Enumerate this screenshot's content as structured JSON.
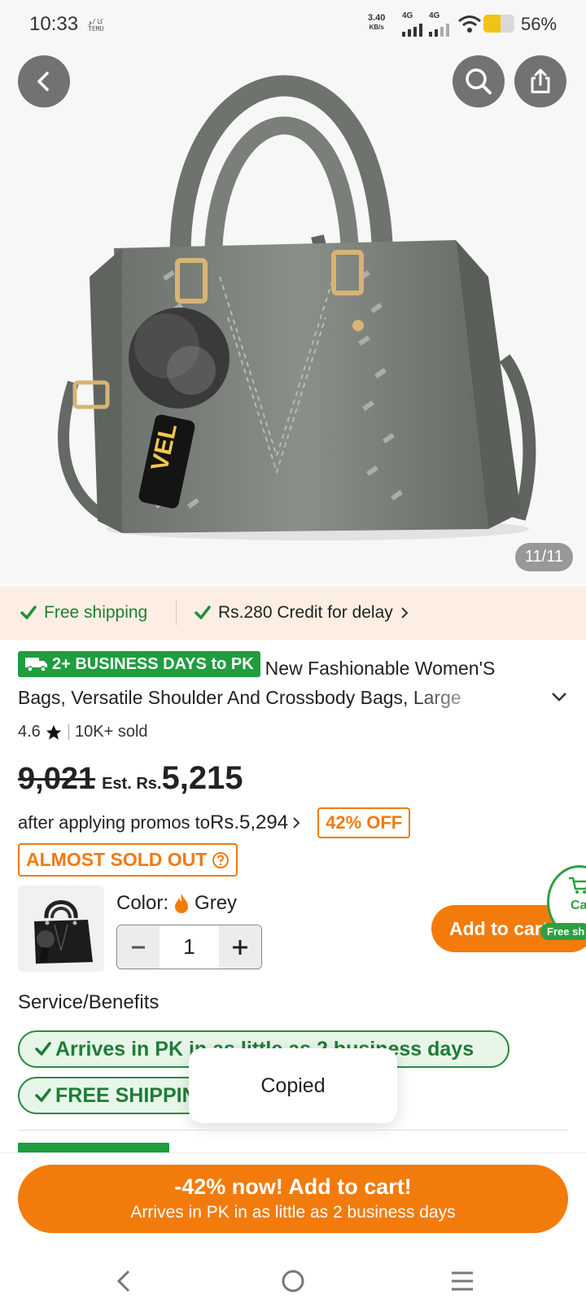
{
  "status_bar": {
    "time": "10:33",
    "app_mark_line1": "ﻛﺎ/ﻭ",
    "app_mark_line2": "TEMU",
    "net_speed": "3.40",
    "net_unit": "KB/s",
    "net_type_1": "4G",
    "net_type_2": "4G",
    "battery_percent": "56%",
    "battery_level": 0.56
  },
  "gallery": {
    "counter": "11/11",
    "back_icon": "chevron-left-icon",
    "search_icon": "search-icon",
    "share_icon": "share-icon"
  },
  "shipping_strip": {
    "free_shipping": "Free shipping",
    "credit": "Rs.280 Credit for delay"
  },
  "product": {
    "badge": "2+ BUSINESS DAYS to PK",
    "title_line1": "New Fashionable Women'S",
    "title_line2": "Bags, Versatile Shoulder And Crossbody Bags, Large",
    "rating": "4.6",
    "sold": "10K+ sold",
    "old_price": "9,021",
    "est_label": "Est. Rs.",
    "new_price": "5,215",
    "promo_text": "after applying promos to ",
    "promo_price": "Rs.5,294",
    "off_badge": "42% OFF",
    "stock_warning": "ALMOST SOLD OUT"
  },
  "options": {
    "color_label": "Color:",
    "color_value": "Grey",
    "quantity": "1",
    "add_to_cart": "Add to cart",
    "cart_peek": "Ca",
    "free_ship_tag": "Free sh"
  },
  "services": {
    "title": "Service/Benefits",
    "pill1": "Arrives in PK in as little as 2 business days",
    "pill2": "FREE SHIPPING"
  },
  "toast": {
    "text": "Copied"
  },
  "bottom_cta": {
    "main": "-42% now! Add to cart!",
    "sub": "Arrives in PK in as little as 2 business days"
  },
  "colors": {
    "accent": "#f37b0b",
    "green": "#1f9d3f",
    "strip_bg": "#fdeee3"
  }
}
